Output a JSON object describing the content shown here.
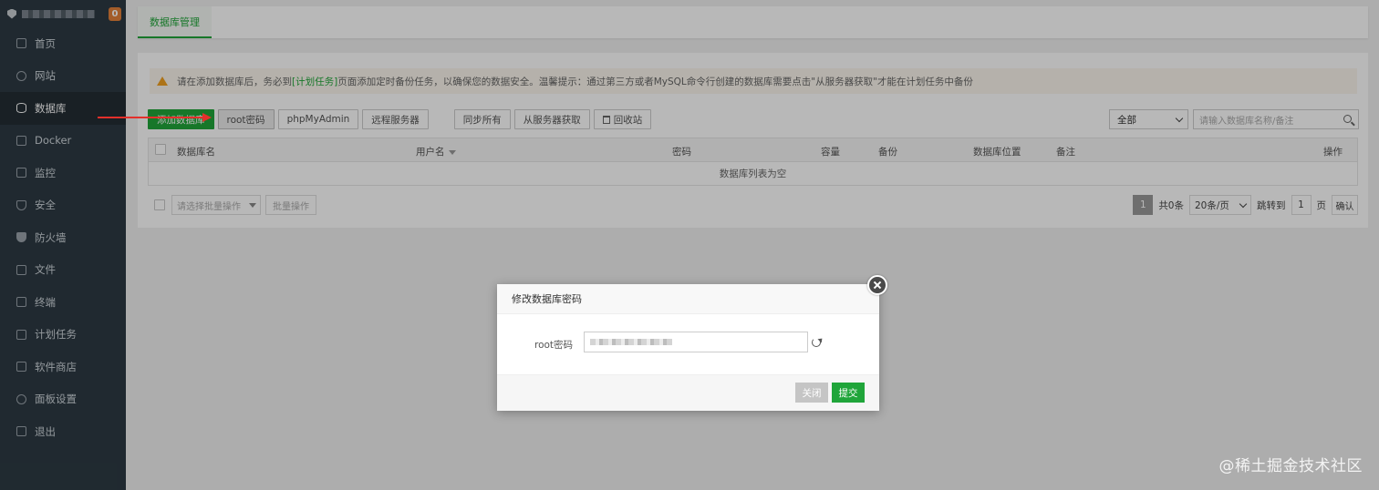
{
  "sidebar": {
    "badge": "0",
    "items": [
      {
        "label": "首页",
        "icon": "home-icon"
      },
      {
        "label": "网站",
        "icon": "globe-icon"
      },
      {
        "label": "数据库",
        "icon": "database-icon"
      },
      {
        "label": "Docker",
        "icon": "docker-icon"
      },
      {
        "label": "监控",
        "icon": "monitor-icon"
      },
      {
        "label": "安全",
        "icon": "shield-icon"
      },
      {
        "label": "防火墙",
        "icon": "firewall-icon"
      },
      {
        "label": "文件",
        "icon": "folder-icon"
      },
      {
        "label": "终端",
        "icon": "terminal-icon"
      },
      {
        "label": "计划任务",
        "icon": "calendar-icon"
      },
      {
        "label": "软件商店",
        "icon": "grid-icon"
      },
      {
        "label": "面板设置",
        "icon": "gear-icon"
      },
      {
        "label": "退出",
        "icon": "logout-icon"
      }
    ]
  },
  "topbar": {
    "tab": "数据库管理"
  },
  "alert": {
    "pre": "请在添加数据库后，务必到",
    "link": "[计划任务]",
    "post": "页面添加定时备份任务，以确保您的数据安全。温馨提示：通过第三方或者MySQL命令行创建的数据库需要点击\"从服务器获取\"才能在计划任务中备份"
  },
  "toolbar": {
    "add": "添加数据库",
    "root_pwd": "root密码",
    "phpmyadmin": "phpMyAdmin",
    "remote": "远程服务器",
    "sync_all": "同步所有",
    "from_server": "从服务器获取",
    "recycle": "回收站"
  },
  "filter": {
    "selected": "全部",
    "placeholder": "请输入数据库名称/备注"
  },
  "table": {
    "columns": [
      "数据库名",
      "用户名",
      "密码",
      "容量",
      "备份",
      "数据库位置",
      "备注",
      "操作"
    ],
    "empty": "数据库列表为空"
  },
  "footer": {
    "batch_placeholder": "请选择批量操作",
    "batch_btn": "批量操作",
    "page": "1",
    "total": "共0条",
    "per_page": "20条/页",
    "jump_label": "跳转到",
    "jump_value": "1",
    "page_unit": "页",
    "confirm": "确认"
  },
  "modal": {
    "title": "修改数据库密码",
    "label": "root密码",
    "close": "关闭",
    "submit": "提交"
  },
  "watermark": "@稀土掘金技术社区",
  "colors": {
    "accent": "#20a53a",
    "sidebar": "#2d3a43",
    "warning": "#f0a020",
    "arrow": "#e3302b"
  }
}
